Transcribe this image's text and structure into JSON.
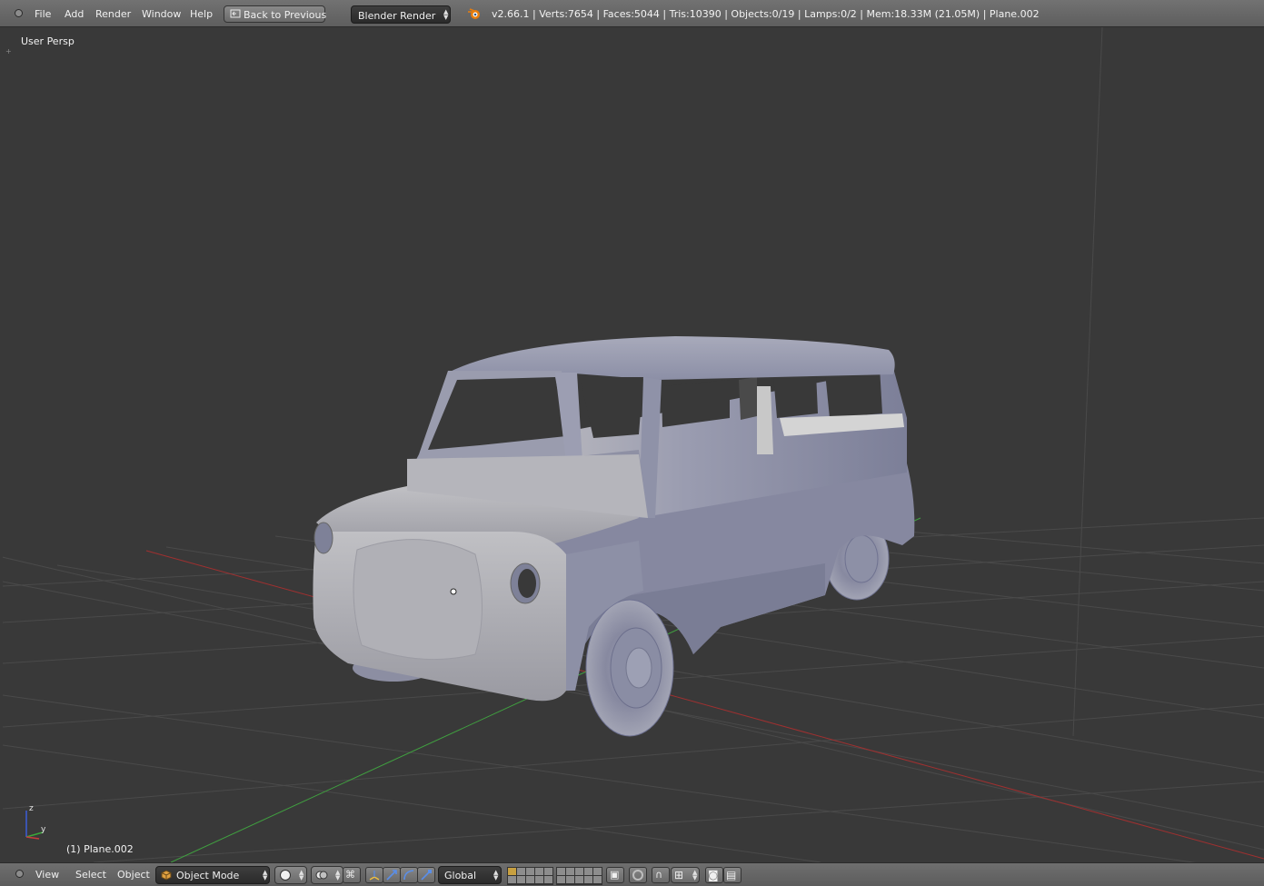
{
  "top_menu": {
    "items": [
      "File",
      "Add",
      "Render",
      "Window",
      "Help"
    ],
    "back_button": "Back to Previous",
    "render_engine": "Blender Render",
    "stats": "v2.66.1 | Verts:7654 | Faces:5044 | Tris:10390 | Objects:0/19 | Lamps:0/2 | Mem:18.33M (21.05M) | Plane.002"
  },
  "viewport": {
    "view_label": "User Persp",
    "object_label": "(1) Plane.002",
    "axis_labels": {
      "z": "z",
      "y": "y"
    }
  },
  "bottom_bar": {
    "menu": [
      "View",
      "Select",
      "Object"
    ],
    "mode": "Object Mode",
    "orientation": "Global"
  },
  "colors": {
    "viewport_bg": "#393939",
    "header_bg": "#6a6a6a",
    "x_axis": "#a03030",
    "y_axis": "#40a040",
    "grid": "#4a4a4a",
    "car_body": "#8e90a6"
  }
}
